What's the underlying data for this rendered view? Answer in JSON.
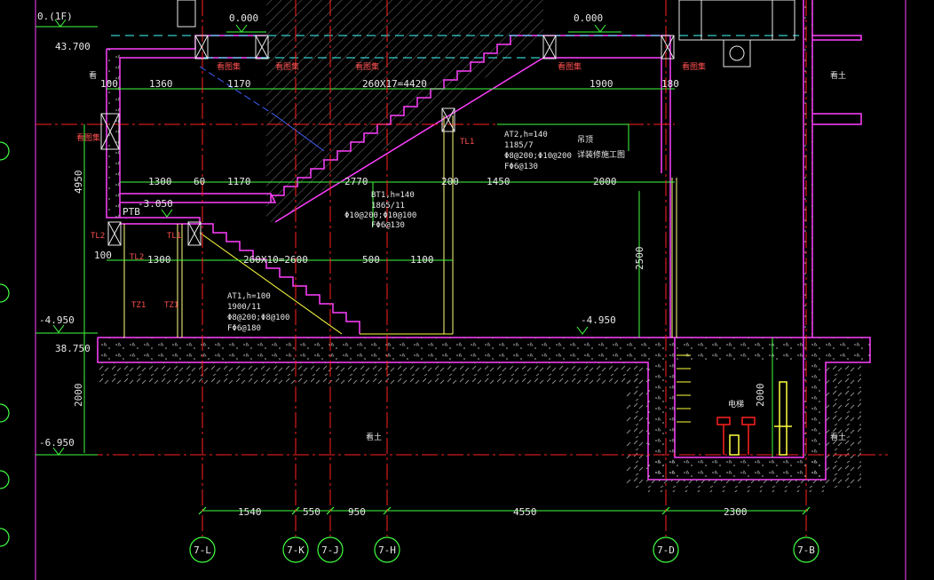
{
  "colors": {
    "background": "#000000",
    "wall": "#ff40ff",
    "grid_axis": "#ff2020",
    "dimension": "#40ff40",
    "stair": "#ffff40",
    "text": "#e8e8e8",
    "column": "#ffff80",
    "level_mark": "#40ff40",
    "accent_cyan": "#40ffff",
    "beam_blue": "#4060ff"
  },
  "levels": {
    "top_left_floor": "0.(1F)",
    "top_mid_zero": "0.000",
    "top_right_zero": "0.000",
    "abs_top": "43.700",
    "mid_landing": "-3.050",
    "lower_floor_left": "-4.950",
    "lower_floor_right": "-4.950",
    "abs_lower": "38.750",
    "pit_bottom": "-6.950"
  },
  "vertical_dims": {
    "left_upper": "4950",
    "left_lower": "2000",
    "right_mid": "2500",
    "right_lower": "2000"
  },
  "dims_row1": {
    "d100": "100",
    "d1360": "1360",
    "d1170": "1170",
    "stair_top": "260X17=4420",
    "d1900": "1900",
    "d180": "180"
  },
  "dims_row2": {
    "d1300": "1300",
    "d60": "60",
    "d1170b": "1170",
    "d2770": "2770",
    "d200": "200",
    "d1450": "1450",
    "d2000": "2000"
  },
  "dims_row3": {
    "d100": "100",
    "d1300": "1300",
    "stair_low": "260X10=2600",
    "d500": "500",
    "d1100": "1100"
  },
  "bottom_dims": {
    "d1540": "1540",
    "d550": "550",
    "d950": "950",
    "d4550": "4550",
    "d2300": "2300"
  },
  "axes": [
    "7-L",
    "7-K",
    "7-J",
    "7-H",
    "7-D",
    "7-B"
  ],
  "tags": {
    "ptb": "PTB",
    "tl1_upper": "TL1",
    "tl1_mid": "TL1",
    "tl2_left": "TL2",
    "tl2_mid": "TL2",
    "tz1_a": "TZ1",
    "tz1_b": "TZ1"
  },
  "notes_at2": {
    "l1": "AT2,h=140",
    "l2": "1185/7",
    "l3": "Φ8@200;Φ10@200",
    "l4": "FΦ6@130",
    "l5": "吊顶",
    "l6": "详装修施工图"
  },
  "notes_bt1": {
    "l1": "BT1,h=140",
    "l2": "1865/11",
    "l3": "Φ10@200;Φ10@100",
    "l4": "FΦ6@130"
  },
  "notes_at1": {
    "l1": "AT1,h=100",
    "l2": "1900/11",
    "l3": "Φ8@200;Φ8@100",
    "l4": "FΦ6@180"
  },
  "marks": {
    "m1": "看图集",
    "m2": "看图集",
    "m3": "看图集",
    "m4": "看图集",
    "m5": "看图集",
    "m6": "看图集",
    "m7": "电梯",
    "side_left": "看",
    "side_right_top": "看土",
    "side_right_low": "看土",
    "pit_mid": "看土",
    "elev_label": "电梯"
  }
}
